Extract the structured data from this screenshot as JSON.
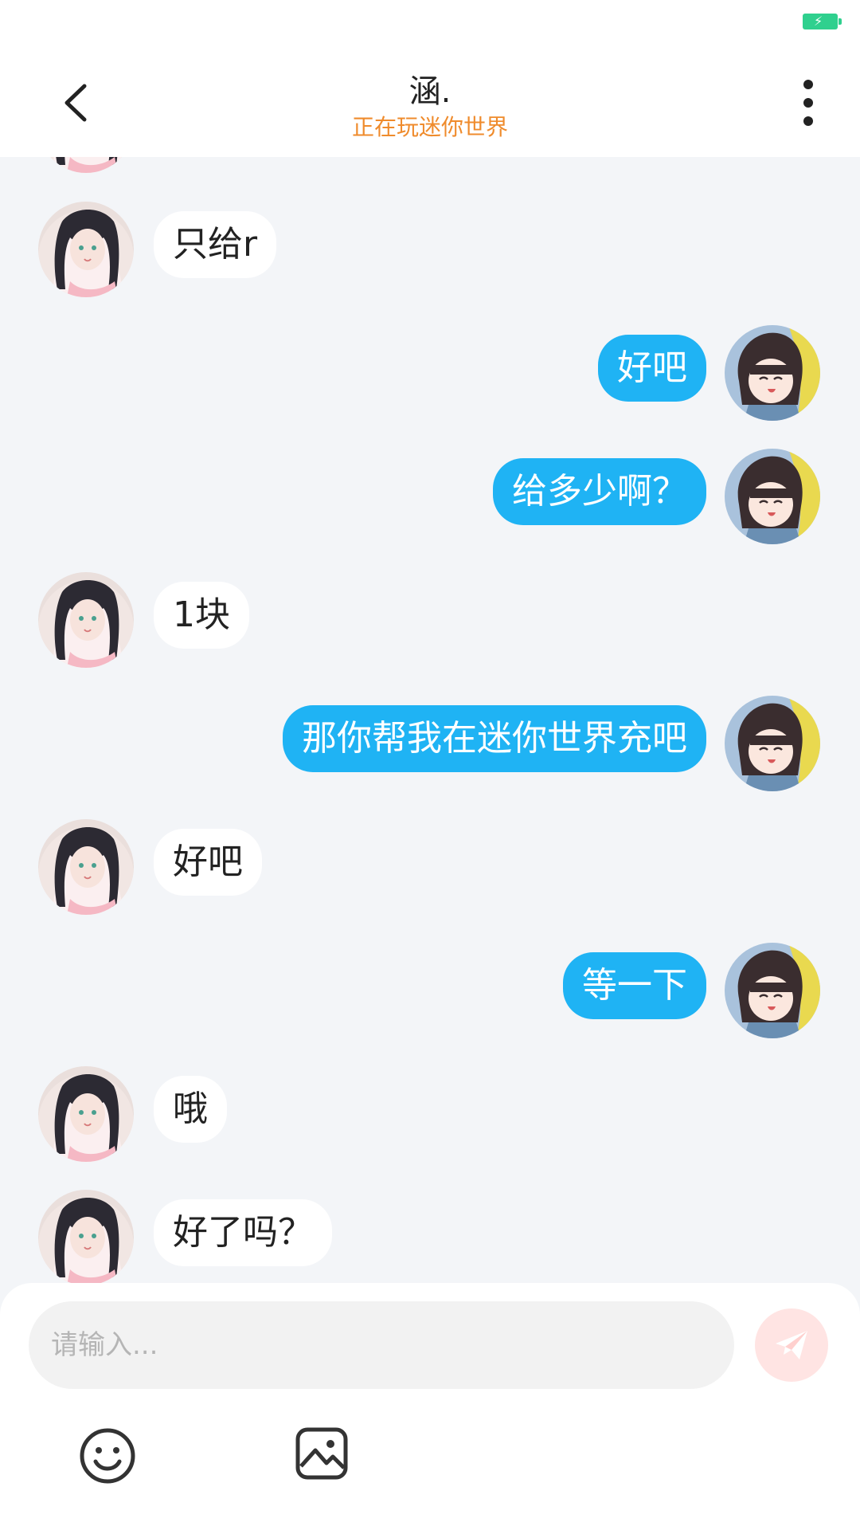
{
  "header": {
    "title": "涵.",
    "subtitle": "正在玩迷你世界"
  },
  "messages": [
    {
      "side": "left",
      "text": "只给r"
    },
    {
      "side": "right",
      "text": "好吧"
    },
    {
      "side": "right",
      "text": "给多少啊？"
    },
    {
      "side": "left",
      "text": "1块"
    },
    {
      "side": "right",
      "text": "那你帮我在迷你世界充吧"
    },
    {
      "side": "left",
      "text": "好吧"
    },
    {
      "side": "right",
      "text": "等一下"
    },
    {
      "side": "left",
      "text": "哦"
    },
    {
      "side": "left",
      "text": "好了吗？"
    }
  ],
  "composer": {
    "placeholder": "请输入..."
  },
  "icons": {
    "back": "chevron-left-icon",
    "more": "more-vertical-icon",
    "send": "send-icon",
    "emoji": "emoji-icon",
    "image": "image-icon"
  },
  "colors": {
    "accent_bubble": "#1fb3f4",
    "subtitle": "#ef8b2c",
    "background": "#f3f5f8"
  }
}
